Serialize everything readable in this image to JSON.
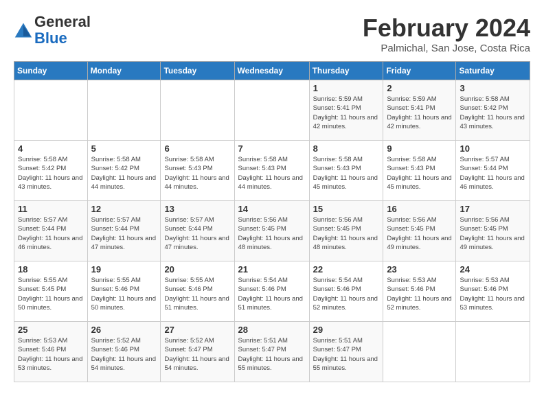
{
  "header": {
    "logo_line1": "General",
    "logo_line2": "Blue",
    "month_year": "February 2024",
    "location": "Palmichal, San Jose, Costa Rica"
  },
  "days_of_week": [
    "Sunday",
    "Monday",
    "Tuesday",
    "Wednesday",
    "Thursday",
    "Friday",
    "Saturday"
  ],
  "weeks": [
    [
      {
        "day": "",
        "info": ""
      },
      {
        "day": "",
        "info": ""
      },
      {
        "day": "",
        "info": ""
      },
      {
        "day": "",
        "info": ""
      },
      {
        "day": "1",
        "info": "Sunrise: 5:59 AM\nSunset: 5:41 PM\nDaylight: 11 hours and 42 minutes."
      },
      {
        "day": "2",
        "info": "Sunrise: 5:59 AM\nSunset: 5:41 PM\nDaylight: 11 hours and 42 minutes."
      },
      {
        "day": "3",
        "info": "Sunrise: 5:58 AM\nSunset: 5:42 PM\nDaylight: 11 hours and 43 minutes."
      }
    ],
    [
      {
        "day": "4",
        "info": "Sunrise: 5:58 AM\nSunset: 5:42 PM\nDaylight: 11 hours and 43 minutes."
      },
      {
        "day": "5",
        "info": "Sunrise: 5:58 AM\nSunset: 5:42 PM\nDaylight: 11 hours and 44 minutes."
      },
      {
        "day": "6",
        "info": "Sunrise: 5:58 AM\nSunset: 5:43 PM\nDaylight: 11 hours and 44 minutes."
      },
      {
        "day": "7",
        "info": "Sunrise: 5:58 AM\nSunset: 5:43 PM\nDaylight: 11 hours and 44 minutes."
      },
      {
        "day": "8",
        "info": "Sunrise: 5:58 AM\nSunset: 5:43 PM\nDaylight: 11 hours and 45 minutes."
      },
      {
        "day": "9",
        "info": "Sunrise: 5:58 AM\nSunset: 5:43 PM\nDaylight: 11 hours and 45 minutes."
      },
      {
        "day": "10",
        "info": "Sunrise: 5:57 AM\nSunset: 5:44 PM\nDaylight: 11 hours and 46 minutes."
      }
    ],
    [
      {
        "day": "11",
        "info": "Sunrise: 5:57 AM\nSunset: 5:44 PM\nDaylight: 11 hours and 46 minutes."
      },
      {
        "day": "12",
        "info": "Sunrise: 5:57 AM\nSunset: 5:44 PM\nDaylight: 11 hours and 47 minutes."
      },
      {
        "day": "13",
        "info": "Sunrise: 5:57 AM\nSunset: 5:44 PM\nDaylight: 11 hours and 47 minutes."
      },
      {
        "day": "14",
        "info": "Sunrise: 5:56 AM\nSunset: 5:45 PM\nDaylight: 11 hours and 48 minutes."
      },
      {
        "day": "15",
        "info": "Sunrise: 5:56 AM\nSunset: 5:45 PM\nDaylight: 11 hours and 48 minutes."
      },
      {
        "day": "16",
        "info": "Sunrise: 5:56 AM\nSunset: 5:45 PM\nDaylight: 11 hours and 49 minutes."
      },
      {
        "day": "17",
        "info": "Sunrise: 5:56 AM\nSunset: 5:45 PM\nDaylight: 11 hours and 49 minutes."
      }
    ],
    [
      {
        "day": "18",
        "info": "Sunrise: 5:55 AM\nSunset: 5:45 PM\nDaylight: 11 hours and 50 minutes."
      },
      {
        "day": "19",
        "info": "Sunrise: 5:55 AM\nSunset: 5:46 PM\nDaylight: 11 hours and 50 minutes."
      },
      {
        "day": "20",
        "info": "Sunrise: 5:55 AM\nSunset: 5:46 PM\nDaylight: 11 hours and 51 minutes."
      },
      {
        "day": "21",
        "info": "Sunrise: 5:54 AM\nSunset: 5:46 PM\nDaylight: 11 hours and 51 minutes."
      },
      {
        "day": "22",
        "info": "Sunrise: 5:54 AM\nSunset: 5:46 PM\nDaylight: 11 hours and 52 minutes."
      },
      {
        "day": "23",
        "info": "Sunrise: 5:53 AM\nSunset: 5:46 PM\nDaylight: 11 hours and 52 minutes."
      },
      {
        "day": "24",
        "info": "Sunrise: 5:53 AM\nSunset: 5:46 PM\nDaylight: 11 hours and 53 minutes."
      }
    ],
    [
      {
        "day": "25",
        "info": "Sunrise: 5:53 AM\nSunset: 5:46 PM\nDaylight: 11 hours and 53 minutes."
      },
      {
        "day": "26",
        "info": "Sunrise: 5:52 AM\nSunset: 5:46 PM\nDaylight: 11 hours and 54 minutes."
      },
      {
        "day": "27",
        "info": "Sunrise: 5:52 AM\nSunset: 5:47 PM\nDaylight: 11 hours and 54 minutes."
      },
      {
        "day": "28",
        "info": "Sunrise: 5:51 AM\nSunset: 5:47 PM\nDaylight: 11 hours and 55 minutes."
      },
      {
        "day": "29",
        "info": "Sunrise: 5:51 AM\nSunset: 5:47 PM\nDaylight: 11 hours and 55 minutes."
      },
      {
        "day": "",
        "info": ""
      },
      {
        "day": "",
        "info": ""
      }
    ]
  ]
}
